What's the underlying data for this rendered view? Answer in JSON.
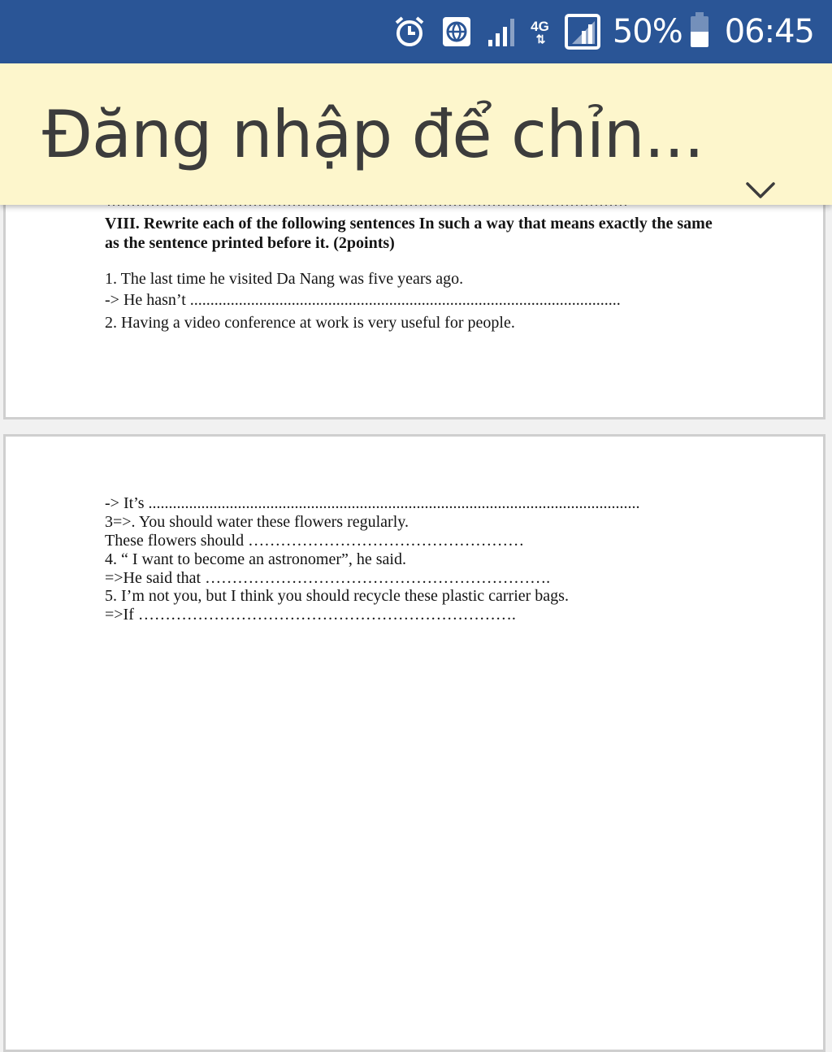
{
  "status_bar": {
    "icons": [
      "alarm-icon",
      "vpn-globe-icon",
      "signal-icon",
      "network-4g-icon",
      "signal-box-icon",
      "battery-icon"
    ],
    "network_type": "4G",
    "battery_percent": "50%",
    "battery_level": 0.5,
    "time": "06:45",
    "color": "#2a5596"
  },
  "login_banner": {
    "title": "Đăng nhập để chỉn...",
    "toggle_icon": "chevron-down-icon",
    "color": "#fdf6cc"
  },
  "document": {
    "page1": {
      "section_heading_line1": "VIII. Rewrite each of the following sentences In such a way that means exactly the same",
      "section_heading_line2": "as the sentence printed before it. (2points)",
      "q1": "1. The last time he visited Da Nang was five years ago.",
      "a1": "-> He hasn’t ..........................................................................................................",
      "q2": "2. Having a video conference at work is very useful for people."
    },
    "page2": {
      "a2": "-> It’s .........................................................................................................................",
      "q3": "3=>. You should water these flowers regularly.",
      "a3": "These flowers should ……………………………………………",
      "q4": "4. “ I want to become an astronomer”, he said.",
      "a4": "=>He said that ……………………………………………………….",
      "q5": "5. I’m not you, but I think you should recycle these plastic carrier bags.",
      "a5": "=>If ……………………………………………………………."
    }
  }
}
